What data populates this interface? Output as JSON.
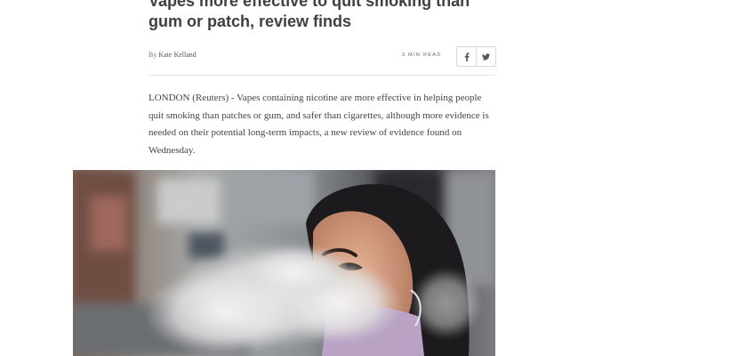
{
  "article": {
    "headline": "Vapes more effective to quit smoking than gum or patch, review finds",
    "byline": {
      "prefix": "By",
      "author": "Kate Kelland"
    },
    "read_time": "3 MIN READ",
    "share": {
      "facebook_icon": "facebook-icon",
      "twitter_icon": "twitter-icon"
    },
    "lede": "LONDON (Reuters) - Vapes containing nicotine are more effective in helping people quit smoking than patches or gum, and safer than cigarettes, although more evidence is needed on their potential long-term impacts, a new review of evidence found on Wednesday.",
    "photo": {
      "subject": "woman-exhaling-vape-smoke"
    }
  }
}
